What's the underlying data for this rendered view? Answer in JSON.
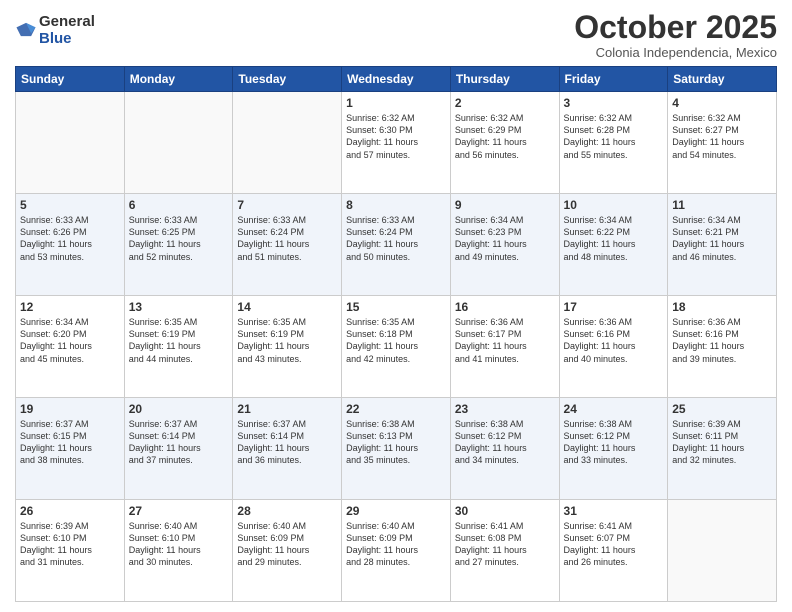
{
  "logo": {
    "general": "General",
    "blue": "Blue"
  },
  "header": {
    "title": "October 2025",
    "subtitle": "Colonia Independencia, Mexico"
  },
  "weekdays": [
    "Sunday",
    "Monday",
    "Tuesday",
    "Wednesday",
    "Thursday",
    "Friday",
    "Saturday"
  ],
  "weeks": [
    [
      {
        "day": "",
        "info": ""
      },
      {
        "day": "",
        "info": ""
      },
      {
        "day": "",
        "info": ""
      },
      {
        "day": "1",
        "info": "Sunrise: 6:32 AM\nSunset: 6:30 PM\nDaylight: 11 hours\nand 57 minutes."
      },
      {
        "day": "2",
        "info": "Sunrise: 6:32 AM\nSunset: 6:29 PM\nDaylight: 11 hours\nand 56 minutes."
      },
      {
        "day": "3",
        "info": "Sunrise: 6:32 AM\nSunset: 6:28 PM\nDaylight: 11 hours\nand 55 minutes."
      },
      {
        "day": "4",
        "info": "Sunrise: 6:32 AM\nSunset: 6:27 PM\nDaylight: 11 hours\nand 54 minutes."
      }
    ],
    [
      {
        "day": "5",
        "info": "Sunrise: 6:33 AM\nSunset: 6:26 PM\nDaylight: 11 hours\nand 53 minutes."
      },
      {
        "day": "6",
        "info": "Sunrise: 6:33 AM\nSunset: 6:25 PM\nDaylight: 11 hours\nand 52 minutes."
      },
      {
        "day": "7",
        "info": "Sunrise: 6:33 AM\nSunset: 6:24 PM\nDaylight: 11 hours\nand 51 minutes."
      },
      {
        "day": "8",
        "info": "Sunrise: 6:33 AM\nSunset: 6:24 PM\nDaylight: 11 hours\nand 50 minutes."
      },
      {
        "day": "9",
        "info": "Sunrise: 6:34 AM\nSunset: 6:23 PM\nDaylight: 11 hours\nand 49 minutes."
      },
      {
        "day": "10",
        "info": "Sunrise: 6:34 AM\nSunset: 6:22 PM\nDaylight: 11 hours\nand 48 minutes."
      },
      {
        "day": "11",
        "info": "Sunrise: 6:34 AM\nSunset: 6:21 PM\nDaylight: 11 hours\nand 46 minutes."
      }
    ],
    [
      {
        "day": "12",
        "info": "Sunrise: 6:34 AM\nSunset: 6:20 PM\nDaylight: 11 hours\nand 45 minutes."
      },
      {
        "day": "13",
        "info": "Sunrise: 6:35 AM\nSunset: 6:19 PM\nDaylight: 11 hours\nand 44 minutes."
      },
      {
        "day": "14",
        "info": "Sunrise: 6:35 AM\nSunset: 6:19 PM\nDaylight: 11 hours\nand 43 minutes."
      },
      {
        "day": "15",
        "info": "Sunrise: 6:35 AM\nSunset: 6:18 PM\nDaylight: 11 hours\nand 42 minutes."
      },
      {
        "day": "16",
        "info": "Sunrise: 6:36 AM\nSunset: 6:17 PM\nDaylight: 11 hours\nand 41 minutes."
      },
      {
        "day": "17",
        "info": "Sunrise: 6:36 AM\nSunset: 6:16 PM\nDaylight: 11 hours\nand 40 minutes."
      },
      {
        "day": "18",
        "info": "Sunrise: 6:36 AM\nSunset: 6:16 PM\nDaylight: 11 hours\nand 39 minutes."
      }
    ],
    [
      {
        "day": "19",
        "info": "Sunrise: 6:37 AM\nSunset: 6:15 PM\nDaylight: 11 hours\nand 38 minutes."
      },
      {
        "day": "20",
        "info": "Sunrise: 6:37 AM\nSunset: 6:14 PM\nDaylight: 11 hours\nand 37 minutes."
      },
      {
        "day": "21",
        "info": "Sunrise: 6:37 AM\nSunset: 6:14 PM\nDaylight: 11 hours\nand 36 minutes."
      },
      {
        "day": "22",
        "info": "Sunrise: 6:38 AM\nSunset: 6:13 PM\nDaylight: 11 hours\nand 35 minutes."
      },
      {
        "day": "23",
        "info": "Sunrise: 6:38 AM\nSunset: 6:12 PM\nDaylight: 11 hours\nand 34 minutes."
      },
      {
        "day": "24",
        "info": "Sunrise: 6:38 AM\nSunset: 6:12 PM\nDaylight: 11 hours\nand 33 minutes."
      },
      {
        "day": "25",
        "info": "Sunrise: 6:39 AM\nSunset: 6:11 PM\nDaylight: 11 hours\nand 32 minutes."
      }
    ],
    [
      {
        "day": "26",
        "info": "Sunrise: 6:39 AM\nSunset: 6:10 PM\nDaylight: 11 hours\nand 31 minutes."
      },
      {
        "day": "27",
        "info": "Sunrise: 6:40 AM\nSunset: 6:10 PM\nDaylight: 11 hours\nand 30 minutes."
      },
      {
        "day": "28",
        "info": "Sunrise: 6:40 AM\nSunset: 6:09 PM\nDaylight: 11 hours\nand 29 minutes."
      },
      {
        "day": "29",
        "info": "Sunrise: 6:40 AM\nSunset: 6:09 PM\nDaylight: 11 hours\nand 28 minutes."
      },
      {
        "day": "30",
        "info": "Sunrise: 6:41 AM\nSunset: 6:08 PM\nDaylight: 11 hours\nand 27 minutes."
      },
      {
        "day": "31",
        "info": "Sunrise: 6:41 AM\nSunset: 6:07 PM\nDaylight: 11 hours\nand 26 minutes."
      },
      {
        "day": "",
        "info": ""
      }
    ]
  ]
}
